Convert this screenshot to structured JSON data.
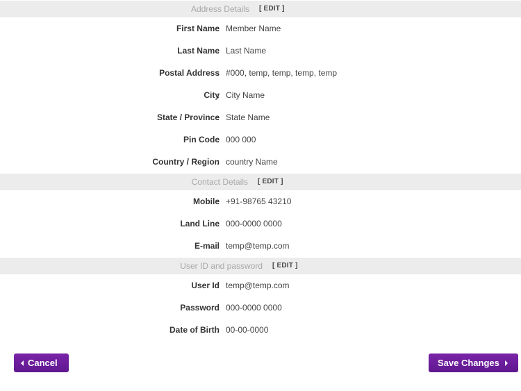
{
  "address": {
    "title": "Address Details",
    "edit": "[ EDIT ]",
    "rows": [
      {
        "label": "First Name",
        "value": "Member Name"
      },
      {
        "label": "Last Name",
        "value": "Last Name"
      },
      {
        "label": "Postal Address",
        "value": "#000, temp, temp, temp, temp"
      },
      {
        "label": "City",
        "value": "City Name"
      },
      {
        "label": "State / Province",
        "value": "State Name"
      },
      {
        "label": "Pin Code",
        "value": "000 000"
      },
      {
        "label": "Country / Region",
        "value": "country Name"
      }
    ]
  },
  "contact": {
    "title": "Contact Details",
    "edit": "[ EDIT ]",
    "rows": [
      {
        "label": "Mobile",
        "value": "+91-98765 43210"
      },
      {
        "label": "Land Line",
        "value": "000-0000 0000"
      },
      {
        "label": "E-mail",
        "value": "temp@temp.com"
      }
    ]
  },
  "credentials": {
    "title": "User ID and password",
    "edit": "[ EDIT ]",
    "rows": [
      {
        "label": "User Id",
        "value": "temp@temp.com"
      },
      {
        "label": "Password",
        "value": "000-0000 0000"
      },
      {
        "label": "Date of Birth",
        "value": "00-00-0000"
      }
    ]
  },
  "colon": ":",
  "actions": {
    "cancel_label": "Cancel",
    "save_label": "Save Changes"
  },
  "colors": {
    "button": "#6a1b9a",
    "header_bg": "#ececec",
    "header_text": "#a8a8a8"
  }
}
